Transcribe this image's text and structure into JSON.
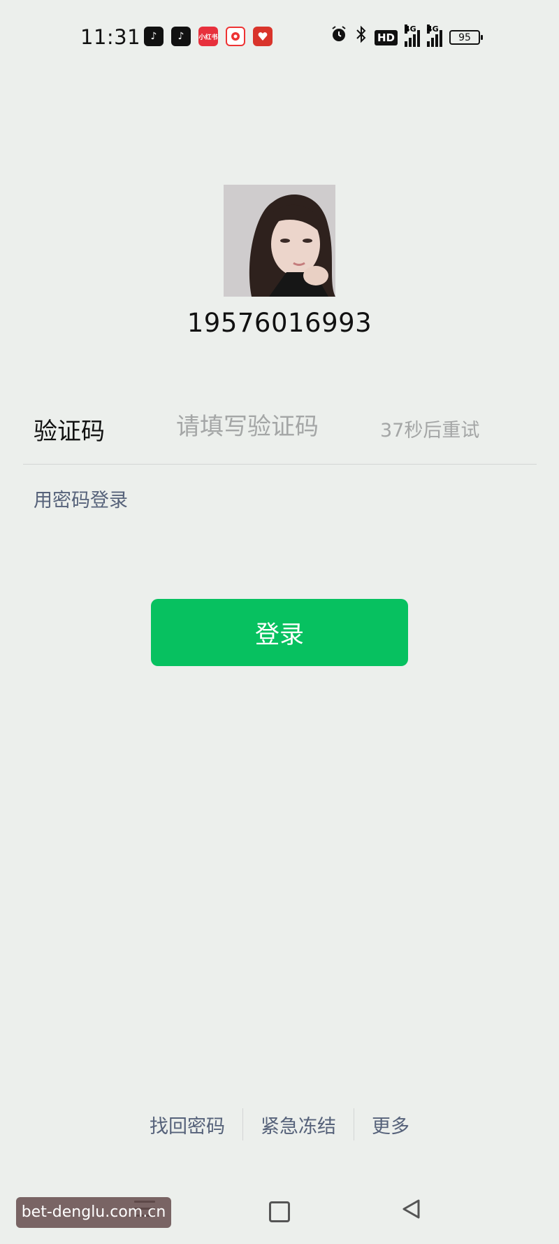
{
  "status_bar": {
    "time": "11:31",
    "app_icons": [
      "douyin-icon",
      "douyin-lite-icon",
      "xiaohongshu-icon",
      "weibo-icon",
      "pinduoduo-icon"
    ],
    "xiaohongshu_label": "小红书",
    "system_icons": [
      "alarm-icon",
      "bluetooth-icon",
      "hd-icon",
      "signal-4g-icon",
      "signal-4g-icon",
      "battery-icon"
    ],
    "hd_label": "HD",
    "network_label": "4G",
    "battery_level": "95"
  },
  "account": {
    "phone": "19576016993"
  },
  "verification": {
    "label": "验证码",
    "placeholder": "请填写验证码",
    "retry_text": "37秒后重试"
  },
  "password_login_link": "用密码登录",
  "login_button": "登录",
  "bottom_links": [
    "找回密码",
    "紧急冻结",
    "更多"
  ],
  "watermark": "bet-denglu.com.cn",
  "colors": {
    "background": "#ecefec",
    "primary_green": "#07c160",
    "link": "#56627a",
    "placeholder": "#a4a6a6"
  }
}
